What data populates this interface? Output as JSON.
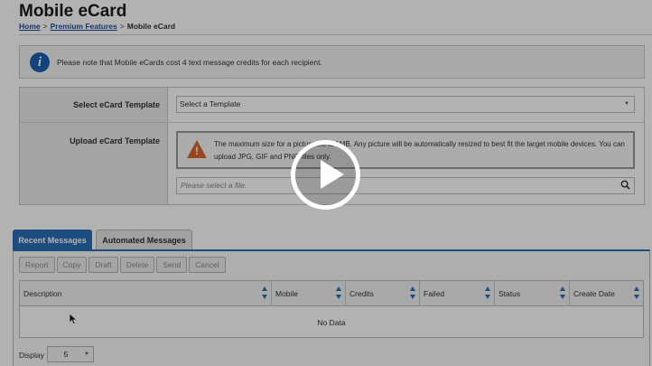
{
  "page": {
    "title": "Mobile eCard",
    "breadcrumb": {
      "home": "Home",
      "separator": ">",
      "premium": "Premium Features",
      "current": "Mobile eCard"
    }
  },
  "info": {
    "icon": "info-icon",
    "text": "Please note that Mobile eCards cost 4 text message credits for each recipient."
  },
  "form": {
    "template_label": "Select eCard Template",
    "template_selected": "Select a Template",
    "upload_label": "Upload eCard Template",
    "warning_icon": "warning-icon",
    "warning_text": "The maximum size for a picture file is 1MB. Any picture will be automatically resized to best fit the target mobile devices. You can upload JPG, GIF and PNG files only.",
    "file_placeholder": "Please select a file.",
    "search_icon": "search-icon"
  },
  "tabs": [
    {
      "label": "Recent Messages",
      "active": true
    },
    {
      "label": "Automated Messages",
      "active": false
    }
  ],
  "toolbar": [
    "Report",
    "Copy",
    "Draft",
    "Delete",
    "Send",
    "Cancel"
  ],
  "table": {
    "columns": [
      "Description",
      "Mobile",
      "Credits",
      "Failed",
      "Status",
      "Create Date"
    ],
    "empty_text": "No Data"
  },
  "paging": {
    "display_label": "Display",
    "display_value": "5"
  },
  "video": {
    "play_icon": "play-icon"
  },
  "colors": {
    "accent": "#2a6fb5",
    "info": "#1a5fb0",
    "warning": "#d9662a",
    "link": "#1f4e9a"
  }
}
